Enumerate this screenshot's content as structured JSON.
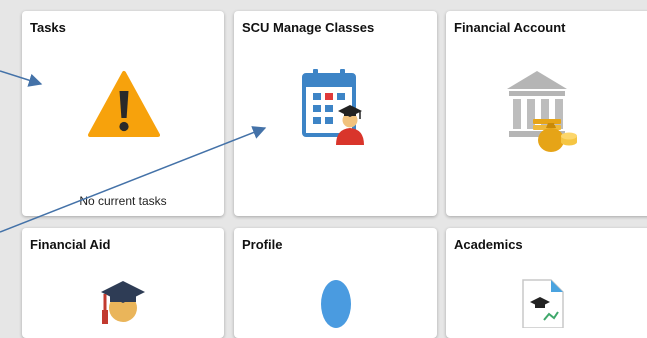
{
  "tiles": {
    "tasks": {
      "title": "Tasks",
      "status": "No current tasks"
    },
    "manage_classes": {
      "title": "SCU Manage Classes"
    },
    "financial_account": {
      "title": "Financial Account"
    },
    "financial_aid": {
      "title": "Financial Aid"
    },
    "profile": {
      "title": "Profile"
    },
    "academics": {
      "title": "Academics"
    }
  },
  "colors": {
    "warning": "#f7a20c",
    "calendar": "#3d84c6",
    "callout_arrow": "#4472a8"
  },
  "icons": {
    "tasks": "warning-icon",
    "manage_classes": "calendar-graduate-icon",
    "financial_account": "bank-money-icon",
    "financial_aid": "graduate-icon",
    "profile": "person-icon",
    "academics": "document-icon"
  }
}
